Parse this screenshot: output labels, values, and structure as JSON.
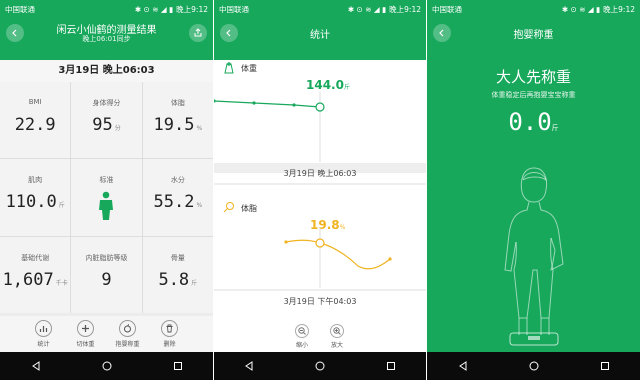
{
  "status": {
    "carrier": "中国联通",
    "time": "晚上9:12",
    "icons": "✱ ⊙ ≋ ◢ ▮"
  },
  "result": {
    "title": "闲云小仙鹤的测量结果",
    "subtitle": "晚上06:01同步",
    "date": "3月19日 晚上06:03",
    "metrics": [
      {
        "label": "BMI",
        "value": "22.9",
        "unit": ""
      },
      {
        "label": "身体得分",
        "value": "95",
        "unit": "分"
      },
      {
        "label": "体脂",
        "value": "19.5",
        "unit": "%"
      },
      {
        "label": "肌肉",
        "value": "110.0",
        "unit": "斤"
      },
      {
        "label": "标准",
        "value": "",
        "unit": ""
      },
      {
        "label": "水分",
        "value": "55.2",
        "unit": "%"
      },
      {
        "label": "基础代谢",
        "value": "1,607",
        "unit": "千卡"
      },
      {
        "label": "内脏脂肪等级",
        "value": "9",
        "unit": ""
      },
      {
        "label": "骨量",
        "value": "5.8",
        "unit": "斤"
      }
    ],
    "toolbar": [
      {
        "label": "统计",
        "icon": "bar-chart-icon"
      },
      {
        "label": "切体重",
        "icon": "plus-icon"
      },
      {
        "label": "抱婴称重",
        "icon": "baby-icon"
      },
      {
        "label": "删除",
        "icon": "trash-icon"
      }
    ]
  },
  "stats": {
    "title": "统计",
    "weight": {
      "label": "体重",
      "value": "144.0",
      "unit": "斤",
      "date": "3月19日 晚上06:03"
    },
    "fat": {
      "label": "体脂",
      "value": "19.8",
      "unit": "%",
      "date": "3月19日 下午04:03"
    },
    "zoom_out": "缩小",
    "zoom_in": "放大",
    "colors": {
      "weight": "#18a85c",
      "fat": "#f0b321"
    }
  },
  "baby": {
    "title": "抱婴称重",
    "heading": "大人先称重",
    "hint": "体重稳定后再抱婴宝宝称重",
    "value": "0.0",
    "unit": "斤"
  },
  "colors": {
    "accent": "#18a85c",
    "nav": "#0b0b0b"
  }
}
